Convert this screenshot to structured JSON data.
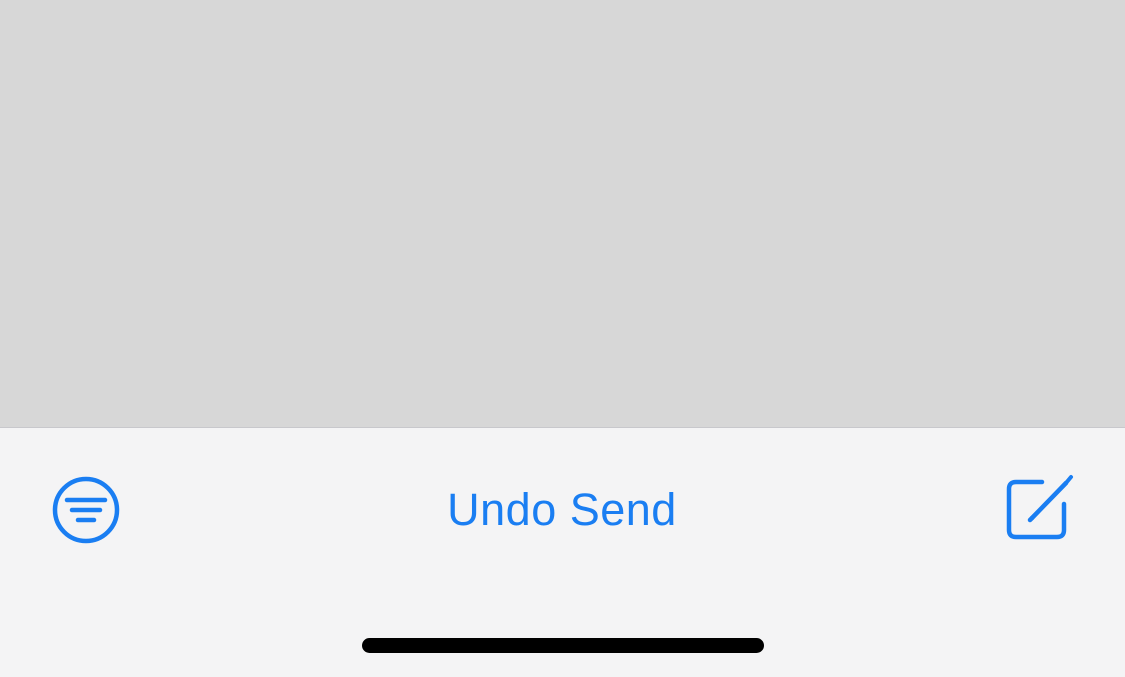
{
  "toolbar": {
    "filter_icon": "filter-circle-icon",
    "center_label": "Undo Send",
    "compose_icon": "compose-icon"
  },
  "colors": {
    "accent": "#1a7ef2",
    "content_background": "#d7d7d7",
    "toolbar_background": "#f4f4f5",
    "home_indicator": "#000000"
  }
}
